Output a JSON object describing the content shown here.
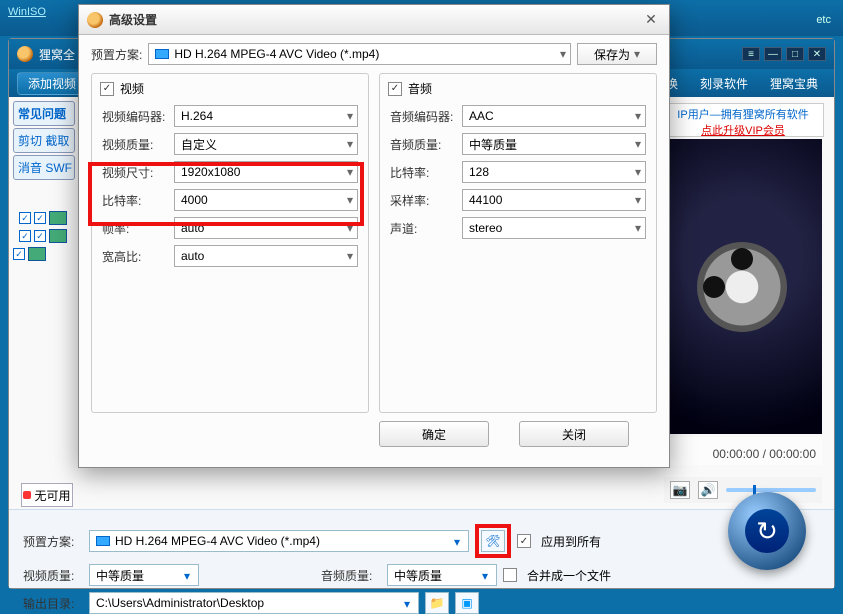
{
  "desktop": {
    "winiso": "WinISO",
    "etc": "etc"
  },
  "app": {
    "title": "狸窝全",
    "add_btn": "添加视频",
    "menu": {
      "convert": "转换",
      "burn": "刻录软件",
      "baodian": "狸窝宝典"
    },
    "window_btns": {
      "min": "—",
      "max": "□",
      "close": "✕",
      "tool": "≡"
    }
  },
  "side_tabs": [
    "常见问题",
    "剪切 截取",
    "消音 SWF"
  ],
  "promo": {
    "line1": "IP用户—拥有狸窝所有软件",
    "line2": "点此升级VIP会员"
  },
  "rec_label": "无可用",
  "time": "00:00:00 / 00:00:00",
  "bottom": {
    "preset_label": "预置方案:",
    "preset_value": "HD H.264 MPEG-4 AVC Video (*.mp4)",
    "apply_all": "应用到所有",
    "vq_label": "视频质量:",
    "vq_value": "中等质量",
    "aq_label": "音频质量:",
    "aq_value": "中等质量",
    "merge": "合并成一个文件",
    "out_label": "输出目录:",
    "out_value": "C:\\Users\\Administrator\\Desktop"
  },
  "dialog": {
    "title": "高级设置",
    "preset_label": "预置方案:",
    "preset_value": "HD H.264 MPEG-4 AVC Video (*.mp4)",
    "save_as": "保存为",
    "video": {
      "group": "视频",
      "encoder_l": "视频编码器:",
      "encoder_v": "H.264",
      "quality_l": "视频质量:",
      "quality_v": "自定义",
      "size_l": "视频尺寸:",
      "size_v": "1920x1080",
      "bitrate_l": "比特率:",
      "bitrate_v": "4000",
      "fps_l": "帧率:",
      "fps_v": "auto",
      "aspect_l": "宽高比:",
      "aspect_v": "auto"
    },
    "audio": {
      "group": "音频",
      "encoder_l": "音频编码器:",
      "encoder_v": "AAC",
      "quality_l": "音频质量:",
      "quality_v": "中等质量",
      "bitrate_l": "比特率:",
      "bitrate_v": "128",
      "sample_l": "采样率:",
      "sample_v": "44100",
      "channel_l": "声道:",
      "channel_v": "stereo"
    },
    "ok": "确定",
    "close": "关闭"
  }
}
